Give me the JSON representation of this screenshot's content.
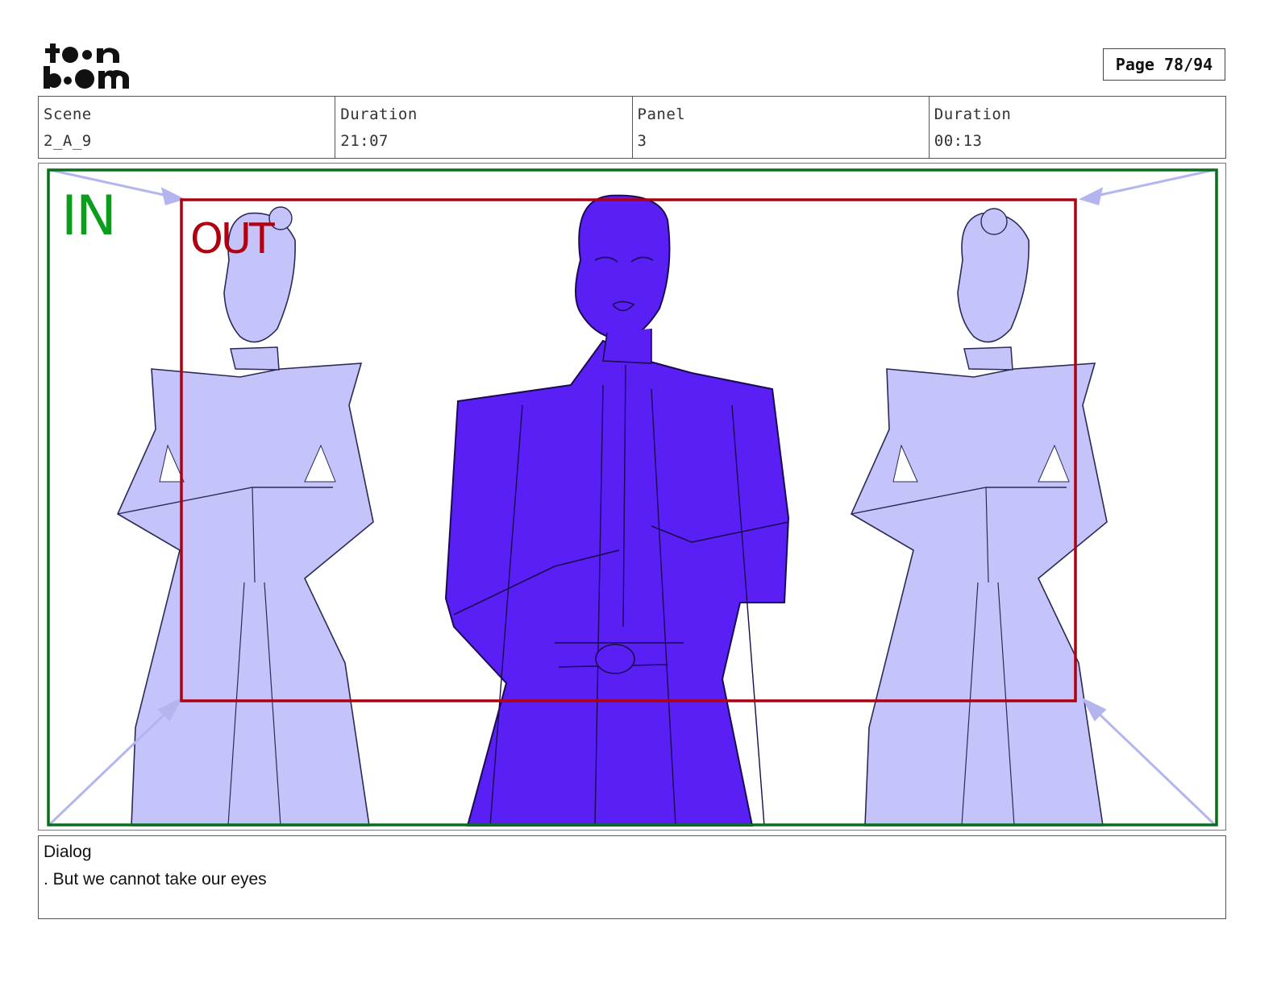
{
  "header": {
    "logo": {
      "icon": "toonboom-logo",
      "top_text": "toon",
      "bottom_text": "boom"
    },
    "page": "Page 78/94"
  },
  "info": {
    "scene_label": "Scene",
    "scene_value": "2_A_9",
    "duration_label": "Duration",
    "duration_value": "21:07",
    "panel_label": "Panel",
    "panel_value": "3",
    "panel_duration_label": "Duration",
    "panel_duration_value": "00:13"
  },
  "panel": {
    "in_label": "IN",
    "out_label": "OUT",
    "colors": {
      "in_frame": "#0a6e1a",
      "out_frame": "#b00010",
      "center_figure": "#5a1ff5",
      "side_figures": "#c4c4fa",
      "arrows": "#b4b4ee"
    }
  },
  "dialog": {
    "label": "Dialog",
    "text": ". But we cannot take our eyes"
  }
}
